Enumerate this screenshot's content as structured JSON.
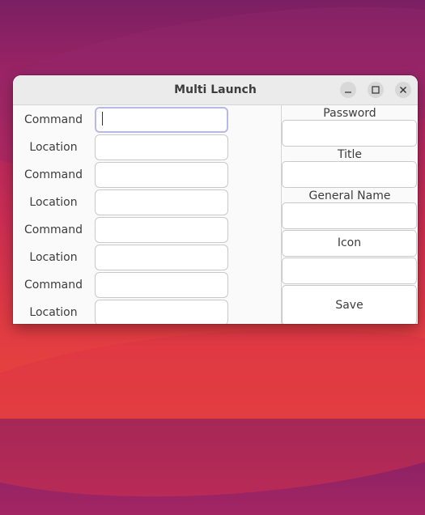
{
  "window": {
    "title": "Multi Launch",
    "controls": [
      "minimize-icon",
      "maximize-icon",
      "close-icon"
    ]
  },
  "left_form": {
    "rows": [
      {
        "label": "Command",
        "value": ""
      },
      {
        "label": "Location",
        "value": ""
      },
      {
        "label": "Command",
        "value": ""
      },
      {
        "label": "Location",
        "value": ""
      },
      {
        "label": "Command",
        "value": ""
      },
      {
        "label": "Location",
        "value": ""
      },
      {
        "label": "Command",
        "value": ""
      },
      {
        "label": "Location",
        "value": ""
      }
    ]
  },
  "right_form": {
    "password_label": "Password",
    "password_value": "",
    "title_label": "Title",
    "title_value": "",
    "general_name_label": "General Name",
    "general_name_value": "",
    "icon_button": "Icon",
    "icon_value": "",
    "save_button": "Save"
  }
}
